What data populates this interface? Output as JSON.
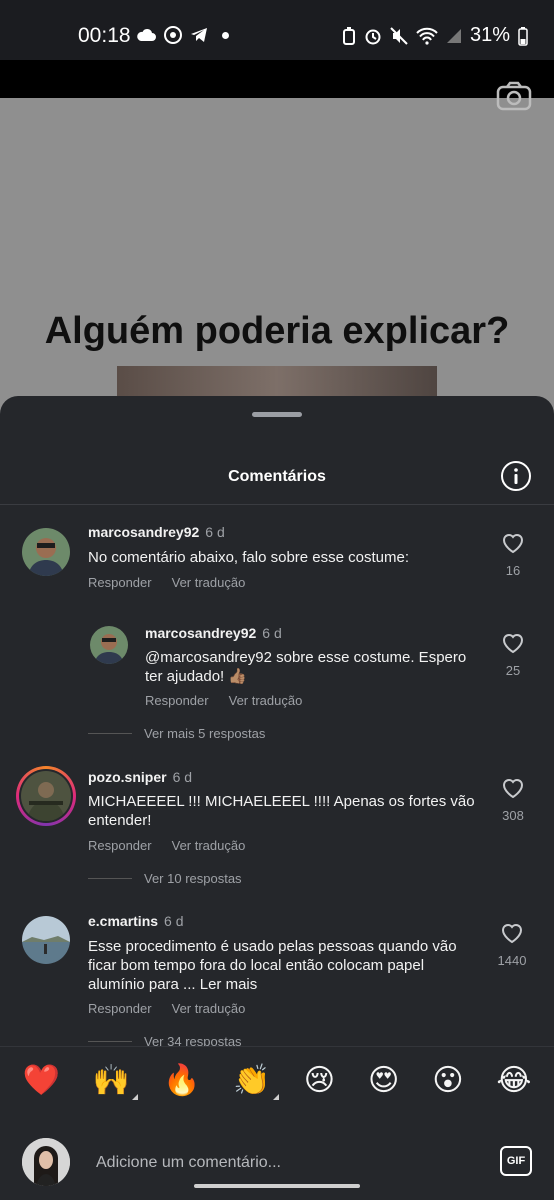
{
  "status_bar": {
    "time": "00:18",
    "battery": "31%",
    "left_icons": [
      "cloud-icon",
      "chrome-icon",
      "telegram-icon",
      "dot-icon"
    ],
    "right_icons": [
      "battery-saver-icon",
      "alarm-icon",
      "mute-icon",
      "wifi-icon",
      "signal-icon",
      "battery-icon"
    ]
  },
  "post": {
    "text": "Alguém poderia explicar?"
  },
  "sheet": {
    "title": "Comentários"
  },
  "comments": [
    {
      "username": "marcosandrey92",
      "age": "6 d",
      "text": "No comentário abaixo, falo sobre esse costume:",
      "reply_label": "Responder",
      "translate_label": "Ver tradução",
      "likes": "16"
    },
    {
      "username": "marcosandrey92",
      "age": "6 d",
      "text": "@marcosandrey92 sobre esse costume. Espero ter ajudado! 👍🏽",
      "reply_label": "Responder",
      "translate_label": "Ver tradução",
      "likes": "25",
      "more_replies": "Ver mais 5 respostas"
    },
    {
      "username": "pozo.sniper",
      "age": "6 d",
      "text": "MICHAEEEEL !!! MICHAELEEEL !!!! Apenas os fortes vão entender!",
      "reply_label": "Responder",
      "translate_label": "Ver tradução",
      "likes": "308",
      "more_replies": "Ver 10 respostas"
    },
    {
      "username": "e.cmartins",
      "age": "6 d",
      "text": "Esse procedimento é usado pelas pessoas quando vão ficar bom tempo fora do local então colocam papel alumínio para ... Ler mais",
      "reply_label": "Responder",
      "translate_label": "Ver tradução",
      "likes": "1440",
      "more_replies": "Ver 34 respostas"
    }
  ],
  "emoji_bar": [
    "❤️",
    "🙌",
    "🔥",
    "👏",
    "😢",
    "😍",
    "😮",
    "😂"
  ],
  "input": {
    "placeholder": "Adicione um comentário...",
    "gif_label": "GIF"
  }
}
